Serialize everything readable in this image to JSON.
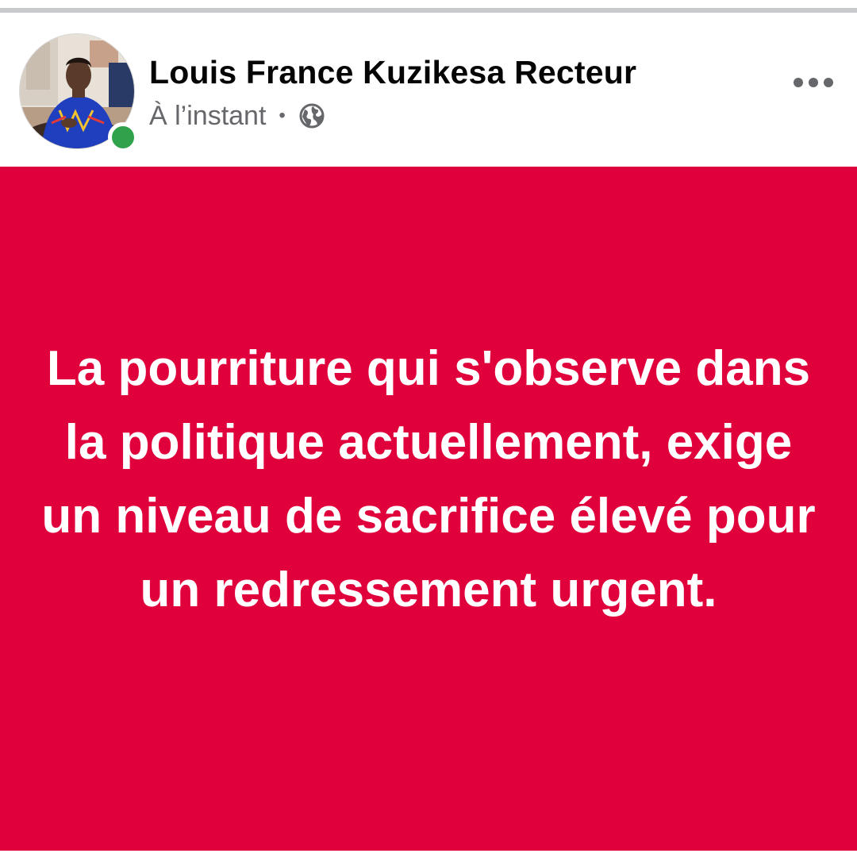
{
  "post": {
    "author_name": "Louis France Kuzikesa Recteur",
    "timestamp": "À l’instant",
    "separator": "•",
    "privacy_icon": "globe-icon",
    "more_icon": "more-options-icon",
    "online_status": "online",
    "body_text": "La pourriture qui s'observe dans la politique actuellement, exige un niveau de sacrifice élevé pour un redressement urgent.",
    "background_color": "#e0003c",
    "text_color": "#ffffff",
    "online_color": "#31a24c"
  }
}
